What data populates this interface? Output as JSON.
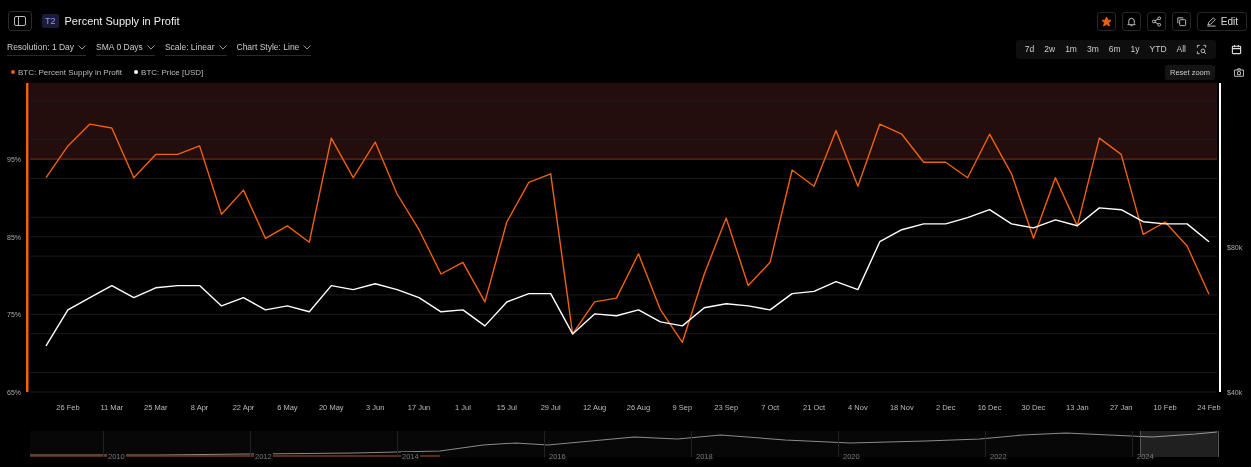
{
  "header": {
    "badge": "T2",
    "title": "Percent Supply in Profit",
    "edit_label": "Edit",
    "starred": true
  },
  "controls": [
    {
      "label": "Resolution: 1 Day"
    },
    {
      "label": "SMA 0 Days"
    },
    {
      "label": "Scale: Linear"
    },
    {
      "label": "Chart Style: Line"
    }
  ],
  "ranges": [
    "7d",
    "2w",
    "1m",
    "3m",
    "6m",
    "1y",
    "YTD",
    "All"
  ],
  "reset_zoom": "Reset zoom",
  "chart_data": {
    "type": "line",
    "categories": [
      null,
      "26 Feb",
      null,
      "11 Mar",
      null,
      "25 Mar",
      null,
      "8 Apr",
      null,
      "22 Apr",
      null,
      "6 May",
      null,
      "20 May",
      null,
      "3 Jun",
      null,
      "17 Jun",
      null,
      "1 Jul",
      null,
      "15 Jul",
      null,
      "29 Jul",
      null,
      "12 Aug",
      null,
      "26 Aug",
      null,
      "9 Sep",
      null,
      "23 Sep",
      null,
      "7 Oct",
      null,
      "21 Oct",
      null,
      "4 Nov",
      null,
      "18 Nov",
      null,
      "2 Dec",
      null,
      "16 Dec",
      null,
      "30 Dec",
      null,
      "13 Jan",
      null,
      "27 Jan",
      null,
      "10 Feb",
      null,
      "24 Feb"
    ],
    "ylim": [
      65,
      104.8
    ],
    "yticks": [
      {
        "value": 65,
        "label": "65%"
      },
      {
        "value": 75,
        "label": "75%"
      },
      {
        "value": 85,
        "label": "85%"
      },
      {
        "value": 95,
        "label": "95%"
      }
    ],
    "y2lim": [
      40,
      125.1
    ],
    "y2ticks": [
      {
        "value": 40,
        "label": "$40k"
      },
      {
        "value": 80,
        "label": "$80k"
      }
    ],
    "series": [
      {
        "name": "BTC: Percent Supply in Profit",
        "color": "#f0600f",
        "values": [
          92.6,
          96.7,
          99.5,
          99,
          92.6,
          95.6,
          95.6,
          96.7,
          87.9,
          91,
          84.8,
          86.4,
          84.3,
          97.7,
          92.6,
          97.2,
          90.5,
          85.9,
          80.2,
          81.7,
          76.6,
          86.9,
          92,
          93.1,
          72.5,
          76.6,
          77.1,
          82.8,
          75.6,
          71.4,
          80.2,
          87.4,
          78.7,
          81.7,
          93.6,
          91.5,
          98.7,
          91.5,
          99.5,
          98.2,
          94.6,
          94.6,
          92.6,
          98.2,
          93.1,
          84.8,
          92.6,
          86.4,
          97.7,
          95.6,
          85.3,
          86.9,
          83.8,
          77.6
        ]
      },
      {
        "name": "BTC: Price [USD]",
        "color": "#ffffff",
        "axis": "y2",
        "values": [
          52.7,
          62.6,
          66,
          69.3,
          66,
          68.7,
          69.3,
          69.3,
          63.7,
          66,
          62.6,
          63.7,
          62.1,
          69.3,
          68.2,
          69.8,
          68.2,
          66,
          62.1,
          62.6,
          58.2,
          64.8,
          67.1,
          67.1,
          56,
          61.5,
          61,
          62.6,
          59.3,
          58.2,
          63.2,
          64.3,
          63.7,
          62.6,
          67.1,
          67.7,
          70.4,
          68.2,
          81.4,
          84.7,
          86.3,
          86.3,
          88,
          90.2,
          86.3,
          85.2,
          87.4,
          85.8,
          90.7,
          90.2,
          86.9,
          86.3,
          86.3,
          81.4
        ]
      }
    ],
    "grid": true,
    "bands": [
      {
        "from": 95,
        "to": 104.8,
        "axis": "y"
      }
    ],
    "ref_lines": [
      {
        "value": 95,
        "axis": "y"
      }
    ]
  },
  "navigator": {
    "years": [
      "2010",
      "2012",
      "2014",
      "2016",
      "2018",
      "2020",
      "2022",
      "2024"
    ]
  }
}
